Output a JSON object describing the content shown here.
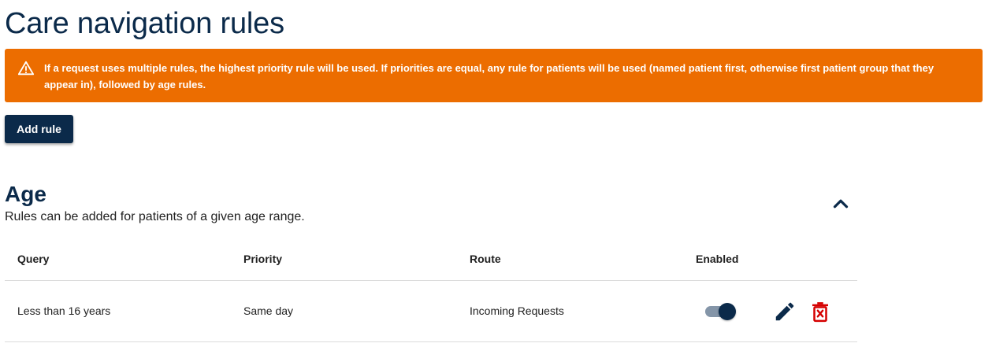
{
  "page": {
    "title": "Care navigation rules"
  },
  "alert": {
    "icon": "warning-icon",
    "text": "If a request uses multiple rules, the highest priority rule will be used. If priorities are equal, any rule for patients will be used (named patient first, otherwise first patient group that they appear in), followed by age rules.",
    "background": "#ec6d00"
  },
  "actions": {
    "add_rule_label": "Add rule"
  },
  "section": {
    "title": "Age",
    "description": "Rules can be added for patients of a given age range.",
    "collapse_icon": "chevron-up-icon"
  },
  "table": {
    "headers": {
      "query": "Query",
      "priority": "Priority",
      "route": "Route",
      "enabled": "Enabled"
    },
    "rows": [
      {
        "query": "Less than 16 years",
        "priority": "Same day",
        "route": "Incoming Requests",
        "enabled": true
      }
    ]
  },
  "colors": {
    "primary": "#0b2a4a",
    "danger": "#d50000",
    "warning": "#ec6d00"
  }
}
